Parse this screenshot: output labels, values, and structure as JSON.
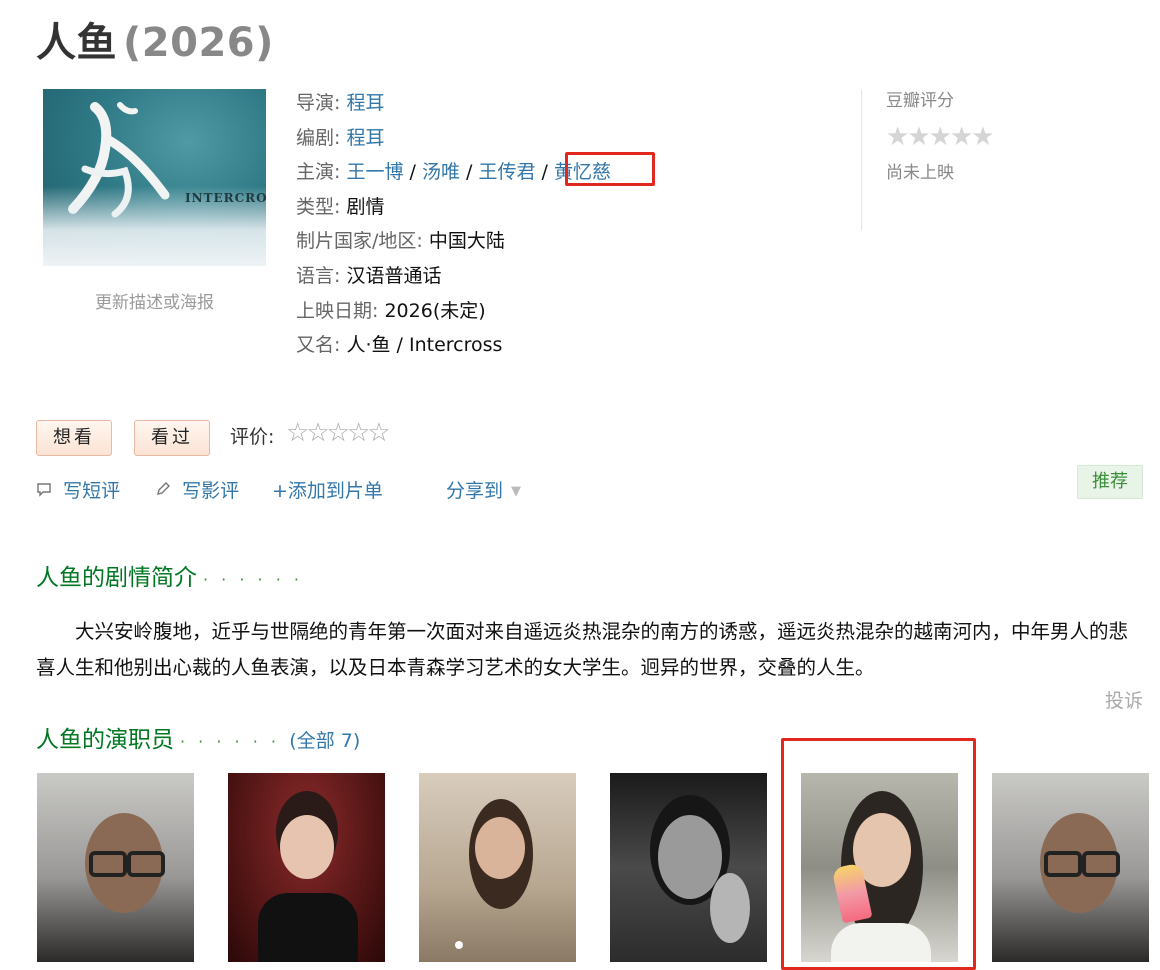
{
  "title": {
    "name": "人鱼",
    "year": "(2026)"
  },
  "poster": {
    "title_glyph": "人鱼",
    "english": "INTERCROSS",
    "caption": "更新描述或海报"
  },
  "info": {
    "director_label": "导演",
    "director": "程耳",
    "writer_label": "编剧",
    "writer": "程耳",
    "cast_label": "主演",
    "cast": [
      "王一博",
      "汤唯",
      "王传君",
      "黄忆慈"
    ],
    "separator": " / ",
    "genre_label": "类型",
    "genre": "剧情",
    "region_label": "制片国家/地区",
    "region": "中国大陆",
    "language_label": "语言",
    "language": "汉语普通话",
    "release_label": "上映日期",
    "release": "2026(未定)",
    "aka_label": "又名",
    "aka": "人·鱼 / Intercross"
  },
  "rating_panel": {
    "label": "豆瓣评分",
    "status": "尚未上映"
  },
  "actions": {
    "want": "想看",
    "seen": "看过",
    "rate_label": "评价:",
    "write_short": "写短评",
    "write_review": "写影评",
    "add_list": "+添加到片单",
    "share": "分享到",
    "recommend": "推荐"
  },
  "plot": {
    "heading": "人鱼的剧情简介",
    "dots": "· · · · · ·",
    "text": "大兴安岭腹地，近乎与世隔绝的青年第一次面对来自遥远炎热混杂的南方的诱惑，遥远炎热混杂的越南河内，中年男人的悲喜人生和他别出心裁的人鱼表演，以及日本青森学习艺术的女大学生。迥异的世界，交叠的人生。",
    "report": "投诉"
  },
  "cast_section": {
    "heading": "人鱼的演职员",
    "dots": "· · · · · ·",
    "all_open": "(",
    "all": "全部 7",
    "all_close": ")"
  },
  "colors": {
    "link": "#3377aa",
    "section_green": "#007722",
    "highlight_red": "#e0281f"
  }
}
